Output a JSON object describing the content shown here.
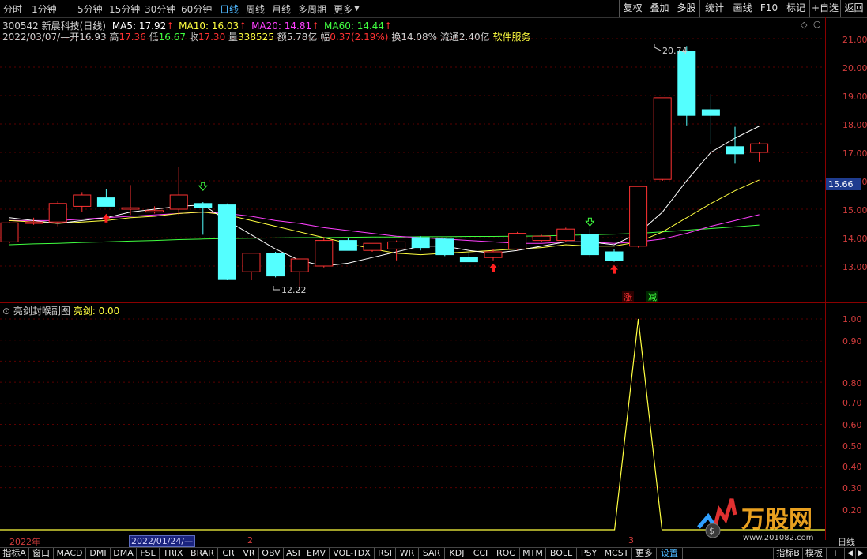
{
  "toolbar": {
    "period_tabs": [
      "分时",
      "1分钟",
      "5分钟",
      "15分钟",
      "30分钟",
      "60分钟",
      "日线",
      "周线",
      "月线",
      "多周期",
      "更多"
    ],
    "active_period": "日线",
    "right_buttons": [
      "复权",
      "叠加",
      "多股",
      "统计",
      "画线",
      "F10",
      "标记",
      "+自选",
      "返回"
    ]
  },
  "stock": {
    "code_name": "300542 新晨科技(日线)",
    "ma5_label": "MA5: 17.92",
    "ma10_label": "MA10: 16.03",
    "ma20_label": "MA20: 14.81",
    "ma60_label": "MA60: 14.44",
    "date": "2022/03/07/—",
    "open_label": "开",
    "open": "16.93",
    "high_label": "高",
    "high": "17.36",
    "low_label": "低",
    "low": "16.67",
    "close_label": "收",
    "close": "17.30",
    "vol_label": "量",
    "vol": "338525",
    "amount_label": "额",
    "amount": "5.78亿",
    "change_label": "幅",
    "change": "0.37(2.19%)",
    "turnover": "换14.08%",
    "float": "流通2.40亿",
    "sector": "软件服务"
  },
  "price_axis": {
    "labels": [
      "21.00",
      "20.00",
      "19.00",
      "18.00",
      "17.00",
      "16.00",
      "15.00",
      "14.00",
      "13.00"
    ],
    "current": "15.66",
    "max_note": "20.74",
    "min_note": "12.22",
    "zhang": "涨",
    "jian": "减"
  },
  "indicator": {
    "title": "亮剑封喉副图",
    "series_label": "亮剑: 0.00",
    "axis_labels": [
      "1.00",
      "0.90",
      "0.80",
      "0.70",
      "0.60",
      "0.50",
      "0.40",
      "0.30",
      "0.20"
    ]
  },
  "time_axis": {
    "labels": [
      "2022年",
      "2022/01/24/—",
      "2",
      "3"
    ],
    "period": "日线"
  },
  "bottom_tabs": [
    "指标A",
    "窗口",
    "MACD",
    "DMI",
    "DMA",
    "FSL",
    "TRIX",
    "BRAR",
    "CR",
    "VR",
    "OBV",
    "ASI",
    "EMV",
    "VOL-TDX",
    "RSI",
    "WR",
    "SAR",
    "KDJ",
    "CCI",
    "ROC",
    "MTM",
    "BOLL",
    "PSY",
    "MCST",
    "更多",
    "设置"
  ],
  "bottom_right": [
    "指标B",
    "模板",
    "+"
  ],
  "watermark": "万股网",
  "watermark_url": "www.201082.com",
  "colors": {
    "up": "#ff3232",
    "down": "#54ffff",
    "ma5": "#ffffff",
    "ma10": "#ffff40",
    "ma20": "#ff40ff",
    "ma60": "#40ff40",
    "axis": "#8b0000"
  },
  "chart_data": {
    "type": "candlestick",
    "y_range": [
      12.0,
      21.5
    ],
    "candles": [
      {
        "o": 13.85,
        "h": 14.55,
        "l": 13.8,
        "c": 14.52
      },
      {
        "o": 14.5,
        "h": 14.7,
        "l": 14.45,
        "c": 14.55
      },
      {
        "o": 14.55,
        "h": 15.3,
        "l": 14.4,
        "c": 15.2
      },
      {
        "o": 15.1,
        "h": 15.6,
        "l": 14.9,
        "c": 15.5
      },
      {
        "o": 15.4,
        "h": 15.7,
        "l": 15.15,
        "c": 15.1
      },
      {
        "o": 15.0,
        "h": 15.85,
        "l": 14.8,
        "c": 15.05
      },
      {
        "o": 14.9,
        "h": 15.1,
        "l": 14.85,
        "c": 14.95
      },
      {
        "o": 15.0,
        "h": 16.5,
        "l": 14.8,
        "c": 15.5
      },
      {
        "o": 15.2,
        "h": 15.25,
        "l": 14.1,
        "c": 15.05
      },
      {
        "o": 15.15,
        "h": 15.2,
        "l": 12.5,
        "c": 12.55
      },
      {
        "o": 12.8,
        "h": 13.4,
        "l": 12.5,
        "c": 13.45
      },
      {
        "o": 13.45,
        "h": 13.5,
        "l": 12.6,
        "c": 12.65
      },
      {
        "o": 12.8,
        "h": 13.1,
        "l": 12.22,
        "c": 13.25
      },
      {
        "o": 13.0,
        "h": 14.0,
        "l": 12.95,
        "c": 13.9
      },
      {
        "o": 13.9,
        "h": 14.0,
        "l": 13.55,
        "c": 13.55
      },
      {
        "o": 13.55,
        "h": 13.8,
        "l": 13.5,
        "c": 13.8
      },
      {
        "o": 13.6,
        "h": 13.9,
        "l": 13.2,
        "c": 13.85
      },
      {
        "o": 14.0,
        "h": 14.05,
        "l": 13.55,
        "c": 13.65
      },
      {
        "o": 13.95,
        "h": 14.0,
        "l": 13.35,
        "c": 13.4
      },
      {
        "o": 13.3,
        "h": 13.5,
        "l": 13.15,
        "c": 13.15
      },
      {
        "o": 13.3,
        "h": 13.6,
        "l": 13.2,
        "c": 13.5
      },
      {
        "o": 13.6,
        "h": 14.2,
        "l": 13.55,
        "c": 14.15
      },
      {
        "o": 13.9,
        "h": 14.1,
        "l": 13.85,
        "c": 14.05
      },
      {
        "o": 13.9,
        "h": 14.35,
        "l": 13.85,
        "c": 14.3
      },
      {
        "o": 14.1,
        "h": 14.3,
        "l": 13.3,
        "c": 13.4
      },
      {
        "o": 13.5,
        "h": 13.6,
        "l": 13.15,
        "c": 13.2
      },
      {
        "o": 13.7,
        "h": 15.8,
        "l": 13.65,
        "c": 15.8
      },
      {
        "o": 16.05,
        "h": 18.92,
        "l": 16.0,
        "c": 18.92
      },
      {
        "o": 20.55,
        "h": 20.74,
        "l": 17.95,
        "c": 18.3
      },
      {
        "o": 18.5,
        "h": 19.05,
        "l": 17.3,
        "c": 18.3
      },
      {
        "o": 17.2,
        "h": 17.9,
        "l": 16.6,
        "c": 16.95
      },
      {
        "o": 17.0,
        "h": 17.36,
        "l": 16.67,
        "c": 17.3
      }
    ],
    "ma5": [
      14.7,
      14.6,
      14.5,
      14.6,
      14.7,
      14.9,
      15.0,
      15.1,
      15.15,
      14.6,
      14.1,
      13.6,
      13.2,
      13.0,
      13.1,
      13.3,
      13.5,
      13.7,
      13.7,
      13.55,
      13.45,
      13.55,
      13.7,
      13.85,
      13.85,
      13.75,
      14.15,
      14.9,
      16.0,
      17.0,
      17.5,
      17.92
    ],
    "ma10": [
      14.6,
      14.55,
      14.5,
      14.55,
      14.6,
      14.7,
      14.75,
      14.85,
      14.9,
      14.8,
      14.6,
      14.4,
      14.2,
      14.0,
      13.8,
      13.6,
      13.45,
      13.4,
      13.45,
      13.5,
      13.55,
      13.6,
      13.65,
      13.75,
      13.7,
      13.7,
      13.85,
      14.2,
      14.7,
      15.2,
      15.65,
      16.03
    ],
    "ma20": [
      14.6,
      14.6,
      14.6,
      14.65,
      14.7,
      14.75,
      14.8,
      14.85,
      14.9,
      14.85,
      14.75,
      14.6,
      14.5,
      14.35,
      14.25,
      14.15,
      14.05,
      14.0,
      13.95,
      13.9,
      13.85,
      13.8,
      13.8,
      13.85,
      13.85,
      13.8,
      13.85,
      13.95,
      14.15,
      14.4,
      14.6,
      14.81
    ],
    "ma60": [
      13.75,
      13.78,
      13.8,
      13.83,
      13.85,
      13.88,
      13.9,
      13.93,
      13.95,
      13.97,
      13.98,
      13.99,
      14.0,
      14.0,
      14.01,
      14.02,
      14.02,
      14.03,
      14.03,
      14.04,
      14.04,
      14.05,
      14.06,
      14.08,
      14.1,
      14.12,
      14.15,
      14.2,
      14.26,
      14.32,
      14.38,
      14.44
    ],
    "indicator_values": [
      0,
      0,
      0,
      0,
      0,
      0,
      0,
      0,
      0,
      0,
      0,
      0,
      0,
      0,
      0,
      0,
      0,
      0,
      0,
      0,
      0,
      0,
      0,
      0,
      0,
      0,
      1,
      0,
      0,
      0,
      0,
      0
    ]
  }
}
